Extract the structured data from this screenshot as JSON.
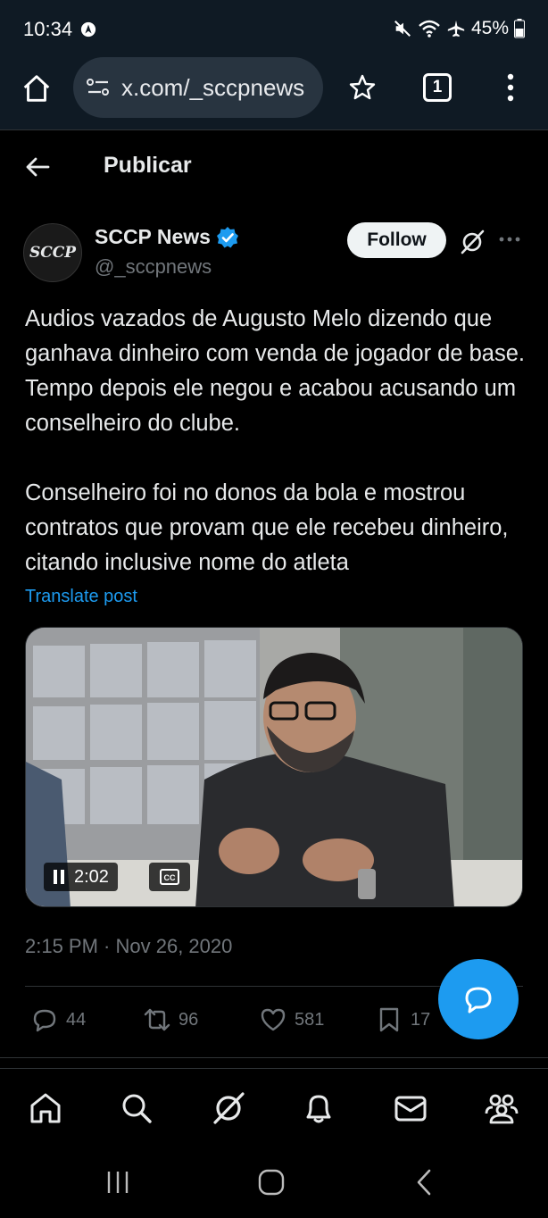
{
  "status_bar": {
    "time": "10:34",
    "battery": "45%",
    "icons": [
      "mute-icon",
      "wifi-icon",
      "airplane-icon",
      "battery-icon",
      "navigation-icon"
    ]
  },
  "browser": {
    "url": "x.com/_sccpnews",
    "tab_count": "1"
  },
  "header": {
    "title": "Publicar"
  },
  "post": {
    "avatar_text": "SCCP",
    "author_name": "SCCP News",
    "handle": "@_sccpnews",
    "follow_label": "Follow",
    "paragraphs": [
      "Audios vazados de Augusto Melo dizendo que ganhava dinheiro com venda de jogador de base. Tempo depois ele negou e acabou acusando um conselheiro do clube.",
      "Conselheiro foi no donos da bola e mostrou contratos que provam que ele recebeu dinheiro, citando inclusive nome do atleta"
    ],
    "translate_label": "Translate post",
    "video": {
      "time": "2:02",
      "cc_label": "CC"
    },
    "timestamp": "2:15 PM · Nov 26, 2020",
    "actions": {
      "replies": "44",
      "reposts": "96",
      "likes": "581",
      "bookmarks": "17"
    }
  },
  "colors": {
    "accent": "#1d9bf0",
    "background": "#000000",
    "secondary_text": "#71767b",
    "browser_bar": "#0f1a24"
  }
}
